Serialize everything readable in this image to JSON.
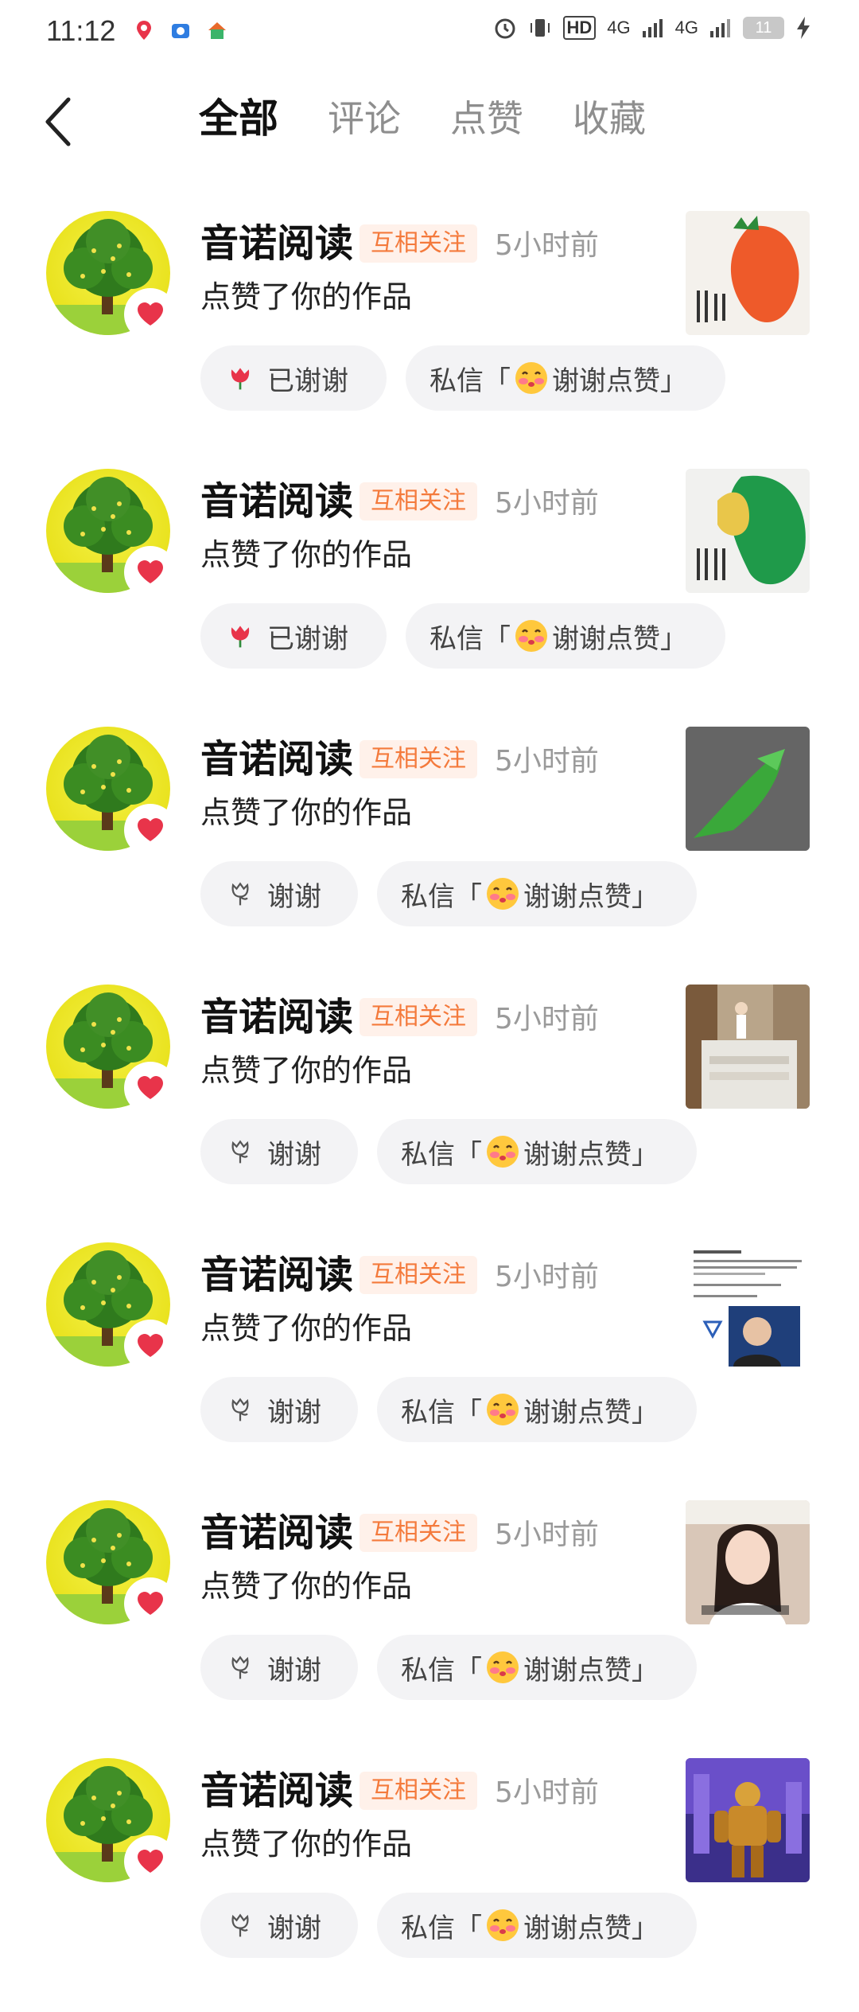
{
  "status_bar": {
    "time": "11:12",
    "network_1": "4G",
    "network_2": "4G",
    "hd_label": "HD",
    "battery": "11"
  },
  "header": {
    "tabs": [
      {
        "label": "全部",
        "active": true
      },
      {
        "label": "评论",
        "active": false
      },
      {
        "label": "点赞",
        "active": false
      },
      {
        "label": "收藏",
        "active": false
      }
    ]
  },
  "notifications": [
    {
      "name": "音诺阅读",
      "badge": "互相关注",
      "time": "5小时前",
      "action": "点赞了你的作品",
      "thanks_label": "已谢谢",
      "thanked": true,
      "dm_prefix": "私信「",
      "dm_text": "谢谢点赞」",
      "thumb": "poster-orange"
    },
    {
      "name": "音诺阅读",
      "badge": "互相关注",
      "time": "5小时前",
      "action": "点赞了你的作品",
      "thanks_label": "已谢谢",
      "thanked": true,
      "dm_prefix": "私信「",
      "dm_text": "谢谢点赞」",
      "thumb": "poster-green"
    },
    {
      "name": "音诺阅读",
      "badge": "互相关注",
      "time": "5小时前",
      "action": "点赞了你的作品",
      "thanks_label": "谢谢",
      "thanked": false,
      "dm_prefix": "私信「",
      "dm_text": "谢谢点赞」",
      "thumb": "photo-leaf"
    },
    {
      "name": "音诺阅读",
      "badge": "互相关注",
      "time": "5小时前",
      "action": "点赞了你的作品",
      "thanks_label": "谢谢",
      "thanked": false,
      "dm_prefix": "私信「",
      "dm_text": "谢谢点赞」",
      "thumb": "photo-room"
    },
    {
      "name": "音诺阅读",
      "badge": "互相关注",
      "time": "5小时前",
      "action": "点赞了你的作品",
      "thanks_label": "谢谢",
      "thanked": false,
      "dm_prefix": "私信「",
      "dm_text": "谢谢点赞」",
      "thumb": "article-portrait"
    },
    {
      "name": "音诺阅读",
      "badge": "互相关注",
      "time": "5小时前",
      "action": "点赞了你的作品",
      "thanks_label": "谢谢",
      "thanked": false,
      "dm_prefix": "私信「",
      "dm_text": "谢谢点赞」",
      "thumb": "photo-woman"
    },
    {
      "name": "音诺阅读",
      "badge": "互相关注",
      "time": "5小时前",
      "action": "点赞了你的作品",
      "thanks_label": "谢谢",
      "thanked": false,
      "dm_prefix": "私信「",
      "dm_text": "谢谢点赞」",
      "thumb": "art-robot"
    }
  ],
  "colors": {
    "accent_orange": "#f47a3c",
    "badge_bg": "#fff1ea",
    "heart_red": "#e8344a",
    "pill_bg": "#f3f3f5"
  }
}
